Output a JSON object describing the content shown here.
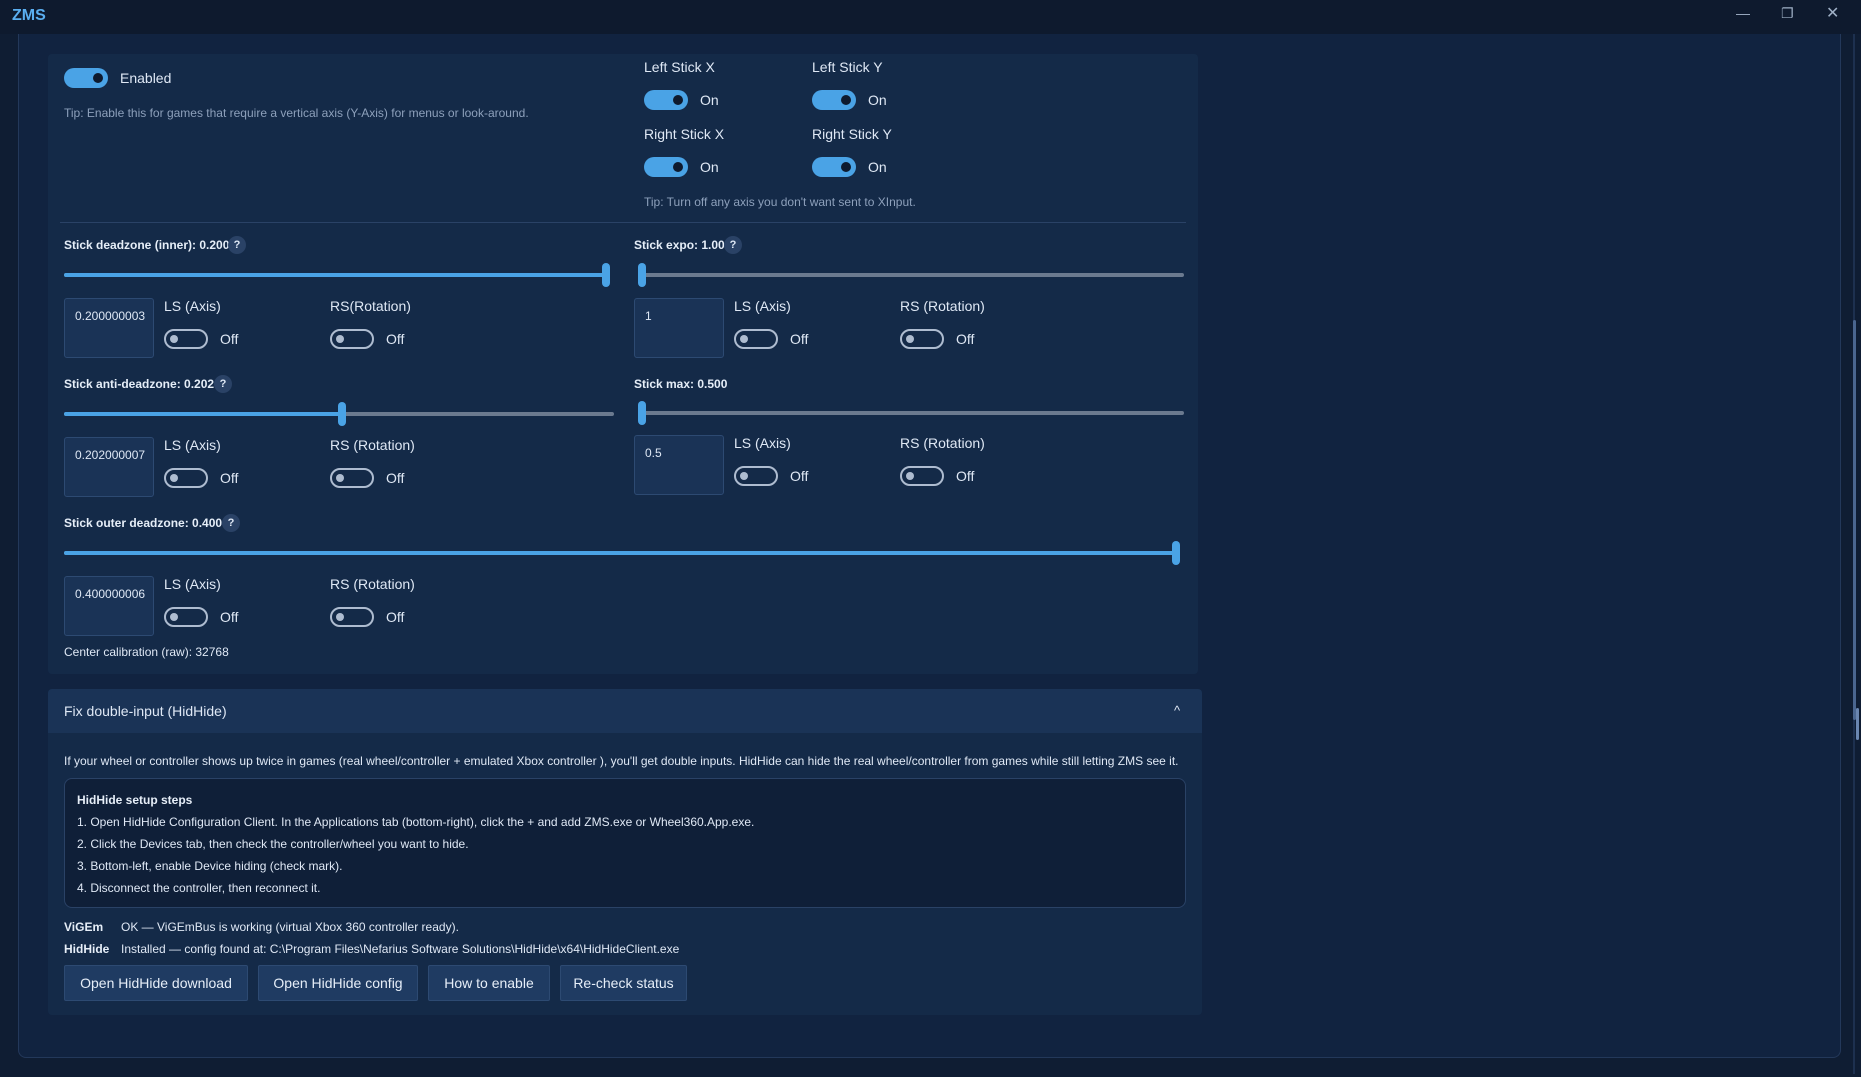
{
  "window": {
    "title": "ZMS",
    "minimize_glyph": "—",
    "maximize_glyph": "❐",
    "close_glyph": "✕"
  },
  "vertical_axis": {
    "toggle_state": true,
    "toggle_label": "Enabled",
    "tip": "Tip: Enable this for games that require a vertical axis (Y-Axis) for menus or look-around."
  },
  "axes": {
    "left_x": {
      "label": "Left Stick X",
      "state": "On"
    },
    "left_y": {
      "label": "Left Stick Y",
      "state": "On"
    },
    "right_x": {
      "label": "Right Stick X",
      "state": "On"
    },
    "right_y": {
      "label": "Right Stick Y",
      "state": "On"
    },
    "tip": "Tip: Turn off any axis you don't want sent to XInput."
  },
  "deadzone_inner": {
    "label": "Stick deadzone (inner): 0.200",
    "help": "?",
    "slider_fraction": 1.0,
    "value": "0.200000003",
    "ls_label": "LS (Axis)",
    "ls_state": "Off",
    "rs_label": "RS(Rotation)",
    "rs_state": "Off"
  },
  "expo": {
    "label": "Stick expo: 1.00",
    "help": "?",
    "slider_fraction": 0.0,
    "value": "1",
    "ls_label": "LS (Axis)",
    "ls_state": "Off",
    "rs_label": "RS (Rotation)",
    "rs_state": "Off"
  },
  "anti_deadzone": {
    "label": "Stick anti-deadzone: 0.202",
    "help": "?",
    "slider_fraction": 0.505,
    "value": "0.202000007",
    "ls_label": "LS (Axis)",
    "ls_state": "Off",
    "rs_label": "RS (Rotation)",
    "rs_state": "Off"
  },
  "stick_max": {
    "label": "Stick max: 0.500",
    "slider_fraction": 0.0,
    "value": "0.5",
    "ls_label": "LS (Axis)",
    "ls_state": "Off",
    "rs_label": "RS (Rotation)",
    "rs_state": "Off"
  },
  "outer_deadzone": {
    "label": "Stick outer deadzone: 0.400",
    "help": "?",
    "slider_fraction": 1.0,
    "value": "0.400000006",
    "ls_label": "LS (Axis)",
    "ls_state": "Off",
    "rs_label": "RS (Rotation)",
    "rs_state": "Off"
  },
  "center_calibration": "Center calibration (raw): 32768",
  "hidhide": {
    "title": "Fix double-input (HidHide)",
    "chevron": "^",
    "description": "If your wheel or controller shows up twice in games (real wheel/controller + emulated Xbox controller ), you'll get double inputs. HidHide can hide the real wheel/controller from games while still letting ZMS see it.",
    "steps_title": "HidHide setup steps",
    "steps": [
      "1. Open HidHide Configuration Client. In the Applications tab (bottom-right), click the + and add ZMS.exe or Wheel360.App.exe.",
      "2. Click the Devices tab, then check the controller/wheel you want to hide.",
      "3. Bottom-left, enable Device hiding (check mark).",
      "4. Disconnect the controller, then reconnect it."
    ],
    "vigem_label": "ViGEm",
    "vigem_status": "OK — ViGEmBus is working (virtual Xbox 360 controller ready).",
    "hidhide_label": "HidHide",
    "hidhide_status": "Installed — config found at: C:\\Program Files\\Nefarius Software Solutions\\HidHide\\x64\\HidHideClient.exe",
    "buttons": {
      "download": "Open HidHide download",
      "config": "Open HidHide config",
      "how": "How to enable",
      "recheck": "Re-check status"
    }
  },
  "colors": {
    "accent": "#4aa3e6",
    "background": "#0f1d33",
    "card": "#142a48"
  }
}
